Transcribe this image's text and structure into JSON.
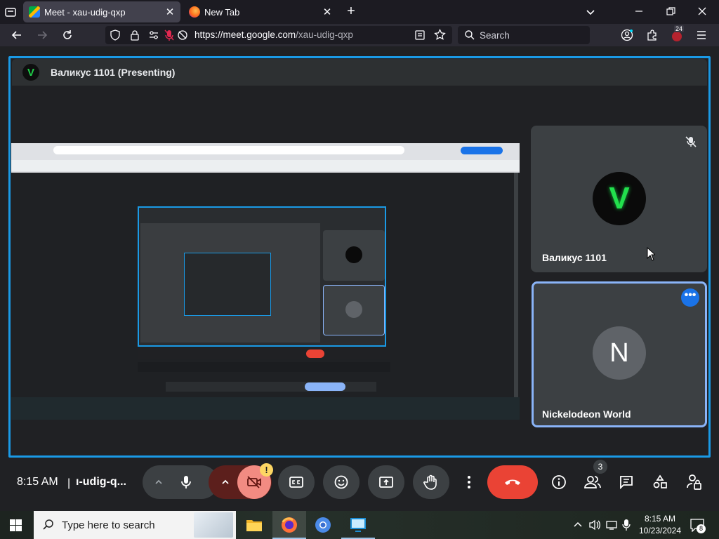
{
  "browser": {
    "tabs": [
      {
        "title": "Meet - xau-udig-qxp",
        "active": true
      },
      {
        "title": "New Tab",
        "active": false
      }
    ],
    "url_host": "https://meet.google.com",
    "url_path": "/xau-udig-qxp",
    "search_placeholder": "Search",
    "extension_badge": "24"
  },
  "meet": {
    "presenter_title": "Валикус 1101 (Presenting)",
    "presenter_initial": "V",
    "participants": [
      {
        "name": "Валикус 1101",
        "initial": "V",
        "muted": true
      },
      {
        "name": "Nickelodeon World",
        "initial": "N",
        "active_speaker": true
      }
    ],
    "participant_count": "3",
    "clock": "8:15 AM",
    "separator": "|",
    "meeting_code": "ı-udig-q...",
    "warning_badge": "!"
  },
  "colors": {
    "accent": "#1a9ae6",
    "end_call": "#ea4335",
    "camera_off": "#f28b82"
  },
  "taskbar": {
    "search_placeholder": "Type here to search",
    "time": "8:15 AM",
    "date": "10/23/2024",
    "notification_count": "8"
  }
}
